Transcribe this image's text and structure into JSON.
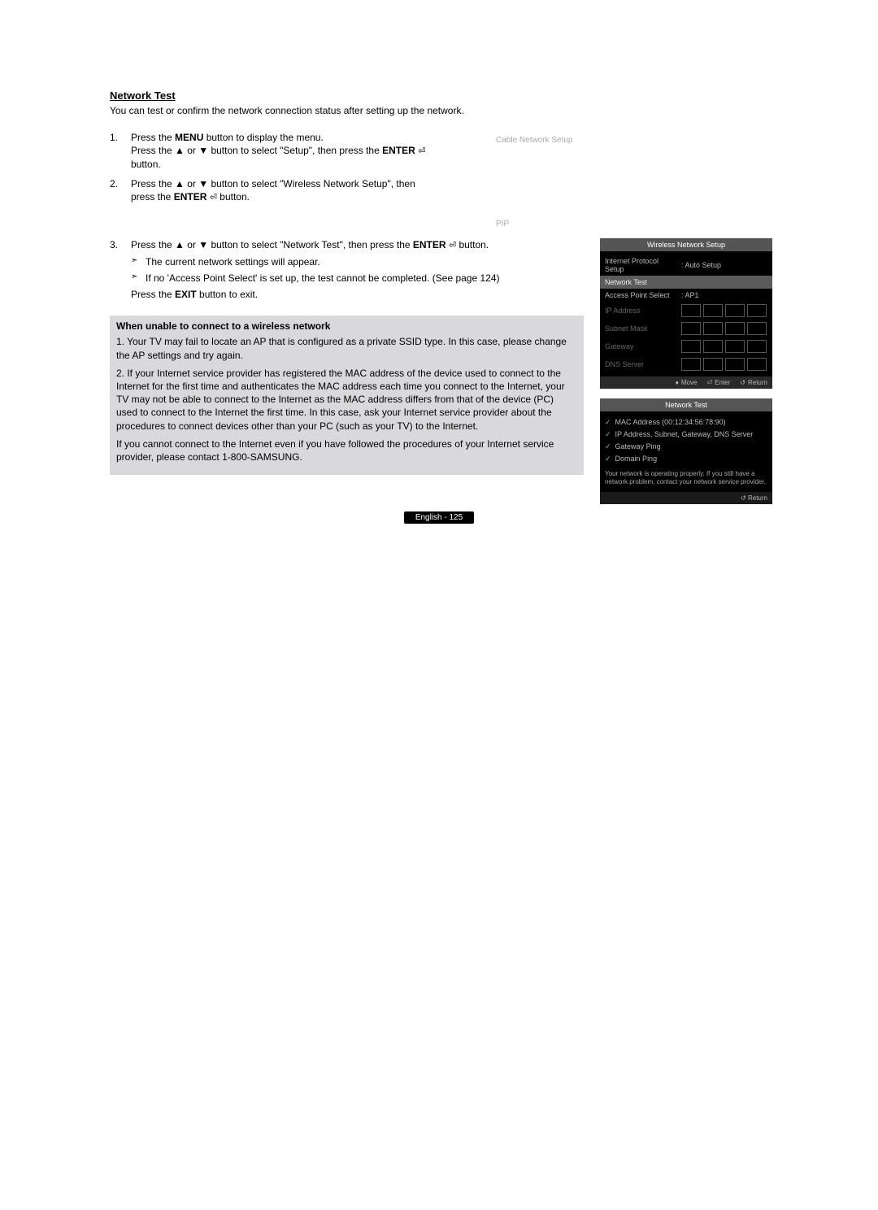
{
  "heading": "Network Test",
  "intro": "You can test or confirm the network connection status after setting up the network.",
  "steps": {
    "s1_num": "1.",
    "s1_a": "Press the ",
    "s1_menu": "MENU",
    "s1_b": " button to display the menu.",
    "s1_c": "Press the ▲ or ▼ button to select \"Setup\", then press the ",
    "s1_enter": "ENTER",
    "s1_d": " button.",
    "s2_num": "2.",
    "s2_a": "Press the ▲ or ▼ button to select \"Wireless Network Setup\", then press the ",
    "s2_enter": "ENTER",
    "s2_b": " button.",
    "s3_num": "3.",
    "s3_a": "Press the ▲ or ▼ button to select \"Network Test\", then press the ",
    "s3_enter": "ENTER",
    "s3_b": " button.",
    "bullet1": "The current network settings will appear.",
    "bullet2": "If no 'Access Point Select' is set up, the test cannot be completed. (See page 124)",
    "exit_a": "Press the ",
    "exit_btn": "EXIT",
    "exit_b": " button to exit."
  },
  "faded": {
    "cable": "Cable Network Setup",
    "pip": "PIP"
  },
  "troubleshoot": {
    "title": "When unable to connect to a wireless network",
    "p1": "1. Your TV may fail to locate an AP that is configured as a private SSID type. In this case, please change the AP settings and try again.",
    "p2": "2. If your Internet service provider has registered the MAC address of the device used to connect to the Internet for the first time and authenticates the MAC address each time you connect to the Internet, your TV may not be able to connect to the Internet as the MAC address differs from that of the device (PC) used to connect to the Internet the first time. In this case, ask your Internet service provider about the procedures to connect devices other than your PC (such as your TV) to the Internet.",
    "p3": "If you cannot connect to the Internet even if you have followed the procedures of your Internet service provider, please contact 1-800-SAMSUNG."
  },
  "osd_setup": {
    "title": "Wireless Network Setup",
    "rows": {
      "ips_label": "Internet Protocol Setup",
      "ips_value": ": Auto Setup",
      "nt_label": "Network Test",
      "aps_label": "Access Point Select",
      "aps_value": ": AP1",
      "ip_label": "IP Address",
      "subnet_label": "Subnet Mask",
      "gateway_label": "Gateway",
      "dns_label": "DNS Server"
    },
    "footer": {
      "move": "Move",
      "enter": "Enter",
      "ret": "Return"
    }
  },
  "osd_test": {
    "title": "Network Test",
    "items": {
      "mac": "MAC Address (00:12:34:56:78:90)",
      "ip": "IP Address, Subnet, Gateway, DNS Server",
      "gping": "Gateway Ping",
      "dping": "Domain Ping"
    },
    "msg": "Your network is operating properly. If you still have a network problem, contact your network service provider.",
    "ret": "Return"
  },
  "footer": "English - 125"
}
